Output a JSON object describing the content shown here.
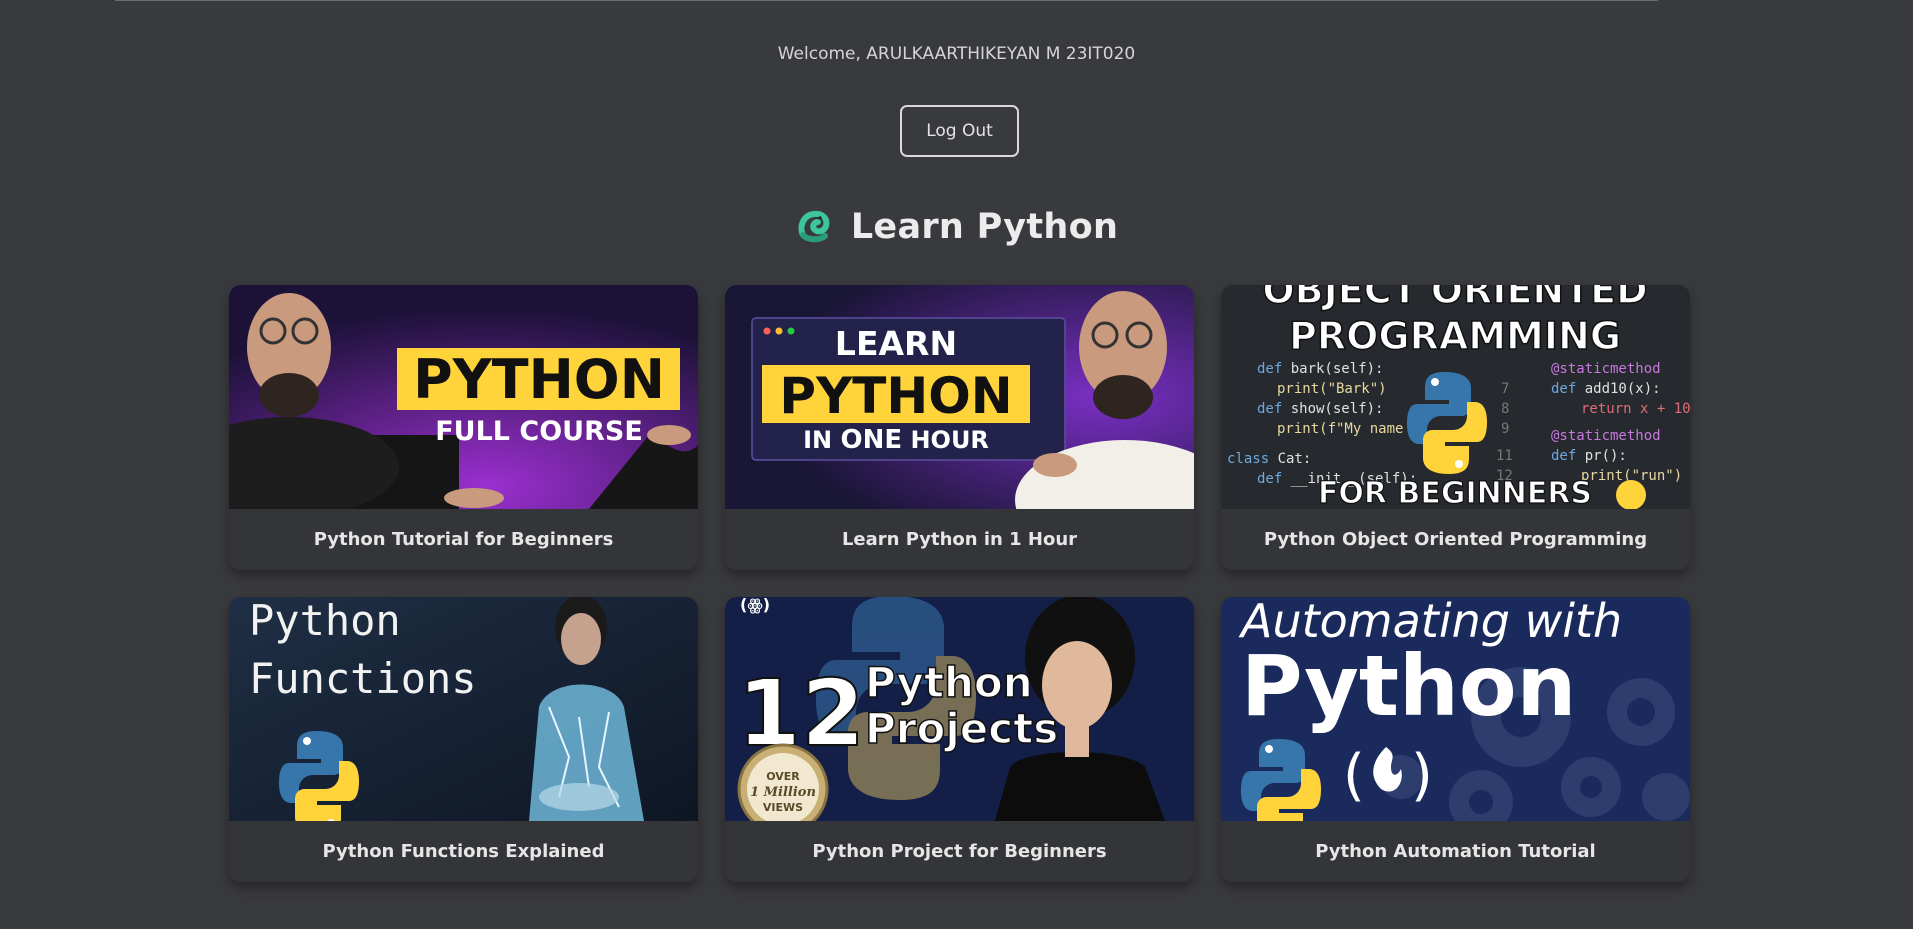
{
  "header": {
    "welcome_text": "Welcome, ARULKAARTHIKEYAN M 23IT020",
    "logout_label": "Log Out"
  },
  "section": {
    "title": "Learn Python",
    "icon": "python-snake-logo-icon"
  },
  "colors": {
    "background": "#393a3d",
    "card": "#343538",
    "accent_green": "#3cc69a",
    "python_yellow": "#ffd43b",
    "python_blue": "#3776ab"
  },
  "videos": [
    {
      "title": "Python Tutorial for Beginners",
      "thumb": {
        "line1": "PYTHON",
        "line2": "FULL COURSE"
      }
    },
    {
      "title": "Learn Python in 1 Hour",
      "thumb": {
        "line1": "LEARN",
        "line2": "PYTHON",
        "line3a": "IN ",
        "line3b": "ONE",
        "line3c": " HOUR"
      }
    },
    {
      "title": "Python Object Oriented Programming",
      "thumb": {
        "line1": "OBJECT ORIENTED",
        "line2": "PROGRAMMING",
        "line3": "FOR BEGINNERS"
      }
    },
    {
      "title": "Python Functions Explained",
      "thumb": {
        "line1": "Python",
        "line2": "Functions"
      }
    },
    {
      "title": "Python Project for Beginners",
      "thumb": {
        "number": "12",
        "line1": "Python",
        "line2": "Projects",
        "badge1": "OVER",
        "badge2": "1 Million",
        "badge3": "VIEWS"
      }
    },
    {
      "title": "Python Automation Tutorial",
      "thumb": {
        "line1": "Automating with",
        "line2": "Python"
      }
    }
  ]
}
